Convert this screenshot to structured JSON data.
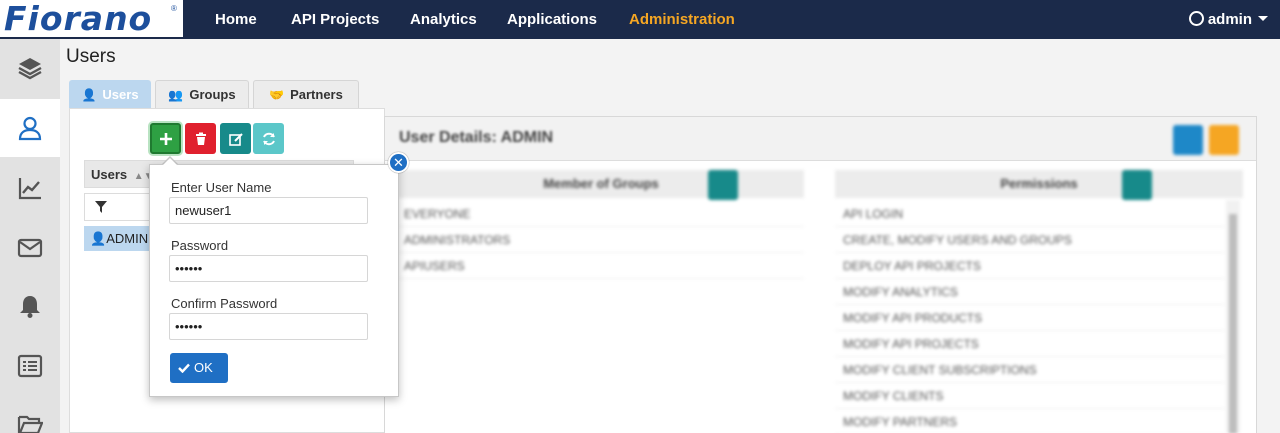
{
  "brand": {
    "logo_text": "Fiorano",
    "logo_mark": "®"
  },
  "nav": {
    "items": [
      {
        "label": "Home"
      },
      {
        "label": "API Projects"
      },
      {
        "label": "Analytics"
      },
      {
        "label": "Applications"
      },
      {
        "label": "Administration",
        "active": true
      }
    ],
    "user_label": "admin"
  },
  "page": {
    "title": "Users"
  },
  "tabs": [
    {
      "label": "Users",
      "icon": "user-icon",
      "active": true
    },
    {
      "label": "Groups",
      "icon": "users-icon"
    },
    {
      "label": "Partners",
      "icon": "handshake-icon"
    }
  ],
  "users_list": {
    "column_header": "Users",
    "rows": [
      {
        "label": "ADMIN",
        "selected": true
      }
    ]
  },
  "popup": {
    "username_label": "Enter User Name",
    "username_value": "newuser1",
    "password_label": "Password",
    "password_value": "••••••",
    "confirm_label": "Confirm Password",
    "confirm_value": "••••••",
    "ok_label": "OK"
  },
  "details": {
    "title": "User Details: ADMIN",
    "groups_header": "Member of Groups",
    "groups": [
      "EVERYONE",
      "ADMINISTRATORS",
      "APIUSERS"
    ],
    "permissions_header": "Permissions",
    "permissions": [
      "API LOGIN",
      "CREATE, MODIFY USERS AND GROUPS",
      "DEPLOY API PROJECTS",
      "MODIFY ANALYTICS",
      "MODIFY API PRODUCTS",
      "MODIFY API PROJECTS",
      "MODIFY CLIENT SUBSCRIPTIONS",
      "MODIFY CLIENTS",
      "MODIFY PARTNERS"
    ]
  },
  "colors": {
    "navbar": "#1b2a4a",
    "active_nav": "#f5a623",
    "add": "#2ea043",
    "delete": "#e0202e",
    "edit": "#178a8a",
    "refresh": "#5bc7c9",
    "primary": "#1f6fc4",
    "save": "#1e88c8",
    "undo": "#f5a623"
  }
}
